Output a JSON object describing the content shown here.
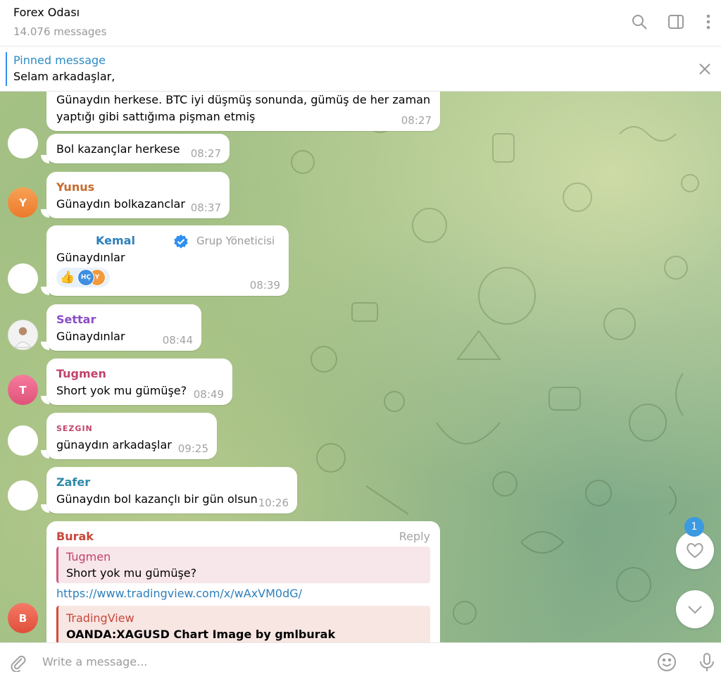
{
  "header": {
    "title": "Forex Odası",
    "subtitle": "14.076 messages",
    "icons": [
      "search-icon",
      "sidebar-toggle-icon",
      "more-vertical-icon"
    ]
  },
  "pinned": {
    "title": "Pinned message",
    "text": "Selam arkadaşlar,"
  },
  "messages": [
    {
      "lines": [
        "Günaydın herkese. BTC iyi düşmüş sonunda, gümüş de her zaman",
        "yaptığı gibi sattığıma pişman etmiş"
      ],
      "time": "08:27"
    },
    {
      "text": "Bol kazançlar herkese",
      "time": "08:27"
    },
    {
      "sender": "Yunus",
      "sender_color": "#c66b2c",
      "avatar_letter": "Y",
      "text": "Günaydın bolkazanclar",
      "time": "08:37"
    },
    {
      "sender": "Kemal",
      "sender_color": "#2d7fbc",
      "role": "Grup Yöneticisi",
      "text": "Günaydınlar",
      "time": "08:39",
      "reaction_initials": [
        "HÇ",
        "Y"
      ]
    },
    {
      "sender": "Settar",
      "sender_color": "#8a4fc7",
      "text": "Günaydınlar",
      "time": "08:44"
    },
    {
      "sender": "Tugmen",
      "sender_color": "#c2436a",
      "avatar_letter": "T",
      "text": "Short yok mu gümüşe?",
      "time": "08:49"
    },
    {
      "sender": "SEZGIN",
      "sender_color": "#c2436a",
      "text": "günaydın arkadaşlar",
      "time": "09:25"
    },
    {
      "sender": "Zafer",
      "sender_color": "#2e8aa8",
      "text": "Günaydın bol kazançlı bir gün olsun",
      "time": "10:26"
    },
    {
      "sender": "Burak",
      "sender_color": "#c8473a",
      "avatar_letter": "B",
      "reply_label": "Reply",
      "reply_to": {
        "sender": "Tugmen",
        "text": "Short yok mu gümüşe?"
      },
      "link": "https://www.tradingview.com/x/wAxVM0dG/",
      "preview": {
        "site": "TradingView",
        "title": "OANDA:XAGUSD Chart Image by gmlburak"
      }
    }
  ],
  "fab": {
    "unread_count": "1"
  },
  "composer": {
    "placeholder": "Write a message..."
  },
  "colors": {
    "accent": "#3390ec",
    "time": "#a3a3a3"
  }
}
